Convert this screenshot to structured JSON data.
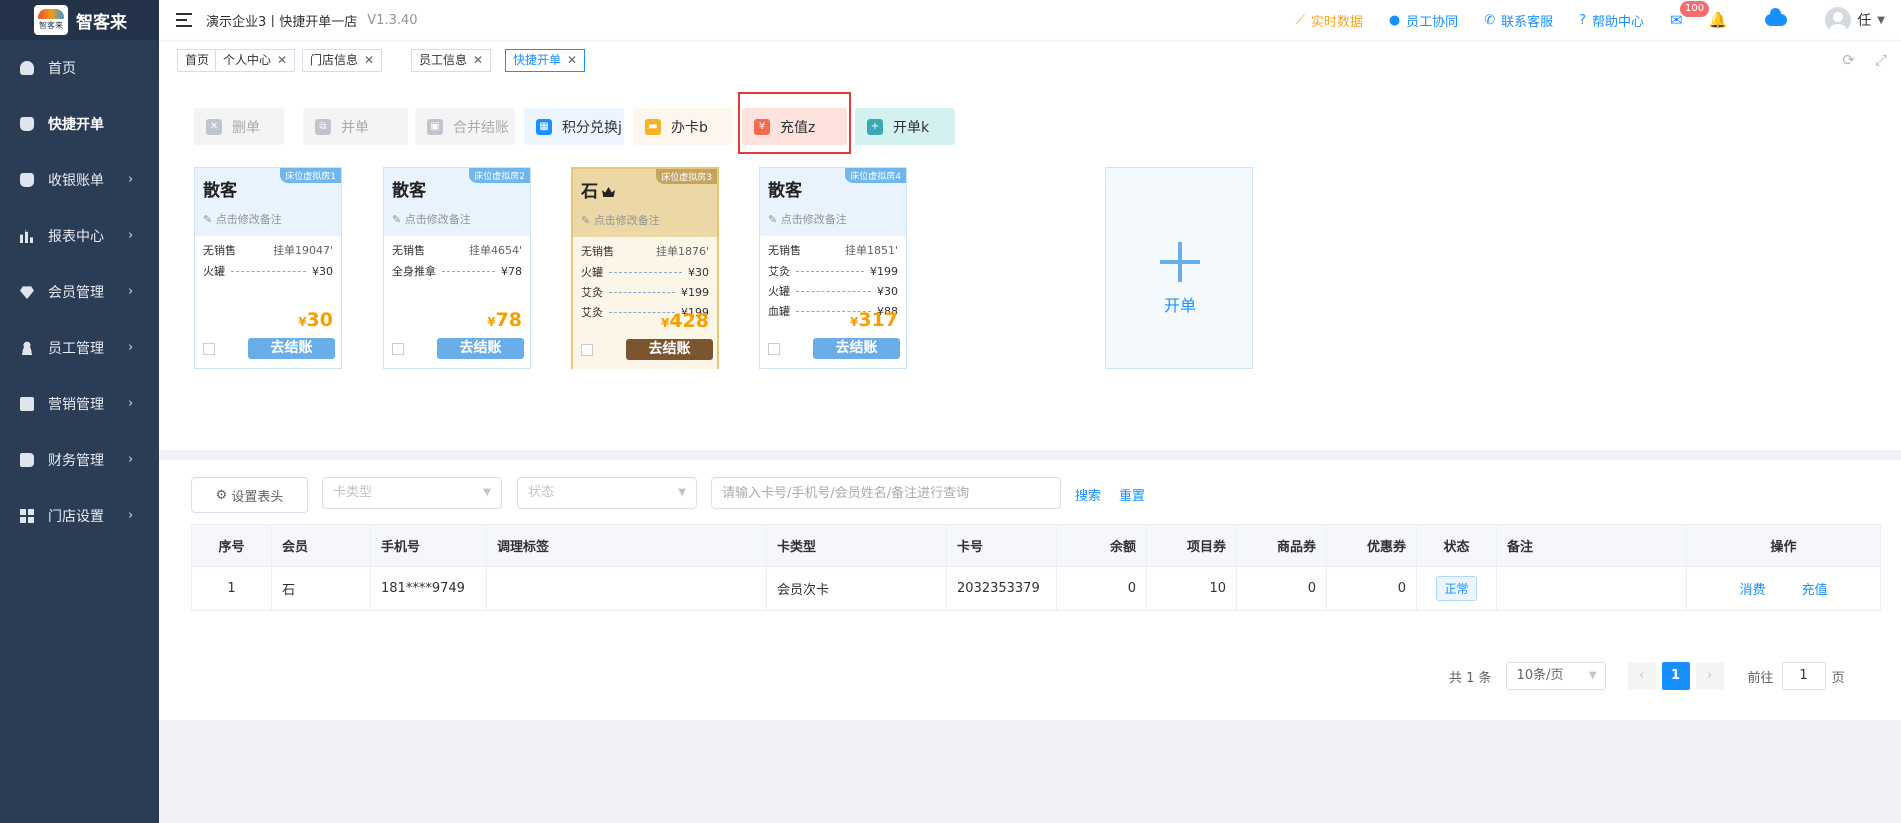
{
  "app": {
    "logo_text": "智客来",
    "logo_small": "智客来"
  },
  "sidebar": {
    "items": [
      {
        "label": "首页"
      },
      {
        "label": "快捷开单"
      },
      {
        "label": "收银账单"
      },
      {
        "label": "报表中心"
      },
      {
        "label": "会员管理"
      },
      {
        "label": "员工管理"
      },
      {
        "label": "营销管理"
      },
      {
        "label": "财务管理"
      },
      {
        "label": "门店设置"
      }
    ]
  },
  "header": {
    "crumb": "演示企业3丨快捷开单一店",
    "version": "V1.3.40",
    "links": {
      "realtime": "实时数据",
      "staff": "员工协同",
      "service": "联系客服",
      "help": "帮助中心"
    },
    "mail_badge": "100",
    "user": "任"
  },
  "tags": [
    {
      "label": "首页"
    },
    {
      "label": "个人中心"
    },
    {
      "label": "门店信息"
    },
    {
      "label": "员工信息"
    },
    {
      "label": "快捷开单"
    }
  ],
  "actions": [
    {
      "label": "删单"
    },
    {
      "label": "并单"
    },
    {
      "label": "合并结账"
    },
    {
      "label": "积分兑换j"
    },
    {
      "label": "办卡b"
    },
    {
      "label": "充值z"
    },
    {
      "label": "开单k"
    }
  ],
  "cards": [
    {
      "title": "散客",
      "room": "床位虚拟房1",
      "note": "点击修改备注",
      "seller": "无销售",
      "order": "挂单19047'",
      "items": [
        {
          "name": "火罐",
          "price": "¥30"
        }
      ],
      "currency": "¥",
      "total": "30",
      "pay": "去结账"
    },
    {
      "title": "散客",
      "room": "床位虚拟房2",
      "note": "点击修改备注",
      "seller": "无销售",
      "order": "挂单4654'",
      "items": [
        {
          "name": "全身推拿",
          "price": "¥78"
        }
      ],
      "currency": "¥",
      "total": "78",
      "pay": "去结账"
    },
    {
      "title": "石",
      "room": "床位虚拟房3",
      "note": "点击修改备注",
      "seller": "无销售",
      "order": "挂单1876'",
      "items": [
        {
          "name": "火罐",
          "price": "¥30"
        },
        {
          "name": "艾灸",
          "price": "¥199"
        },
        {
          "name": "艾灸",
          "price": "¥199"
        }
      ],
      "currency": "¥",
      "total": "428",
      "pay": "去结账"
    },
    {
      "title": "散客",
      "room": "床位虚拟房4",
      "note": "点击修改备注",
      "seller": "无销售",
      "order": "挂单1851'",
      "items": [
        {
          "name": "艾灸",
          "price": "¥199"
        },
        {
          "name": "火罐",
          "price": "¥30"
        },
        {
          "name": "血罐",
          "price": "¥88"
        }
      ],
      "currency": "¥",
      "total": "317",
      "pay": "去结账"
    }
  ],
  "add_card": {
    "label": "开单"
  },
  "filters": {
    "set_header": "设置表头",
    "card_type_placeholder": "卡类型",
    "status_placeholder": "状态",
    "search_placeholder": "请输入卡号/手机号/会员姓名/备注进行查询",
    "search": "搜索",
    "reset": "重置"
  },
  "table": {
    "columns": [
      "序号",
      "会员",
      "手机号",
      "调理标签",
      "卡类型",
      "卡号",
      "余额",
      "项目券",
      "商品券",
      "优惠券",
      "状态",
      "备注",
      "操作"
    ],
    "rows": [
      {
        "idx": "1",
        "member": "石",
        "phone": "181****9749",
        "tag": "",
        "card_type": "会员次卡",
        "card_no": "2032353379",
        "balance": "0",
        "project": "10",
        "goods": "0",
        "coupon": "0",
        "status": "正常",
        "remark": "",
        "op1": "消费",
        "op2": "充值"
      }
    ]
  },
  "pager": {
    "total": "共 1 条",
    "size": "10条/页",
    "page": "1",
    "goto": "前往",
    "goto_value": "1",
    "unit": "页"
  }
}
